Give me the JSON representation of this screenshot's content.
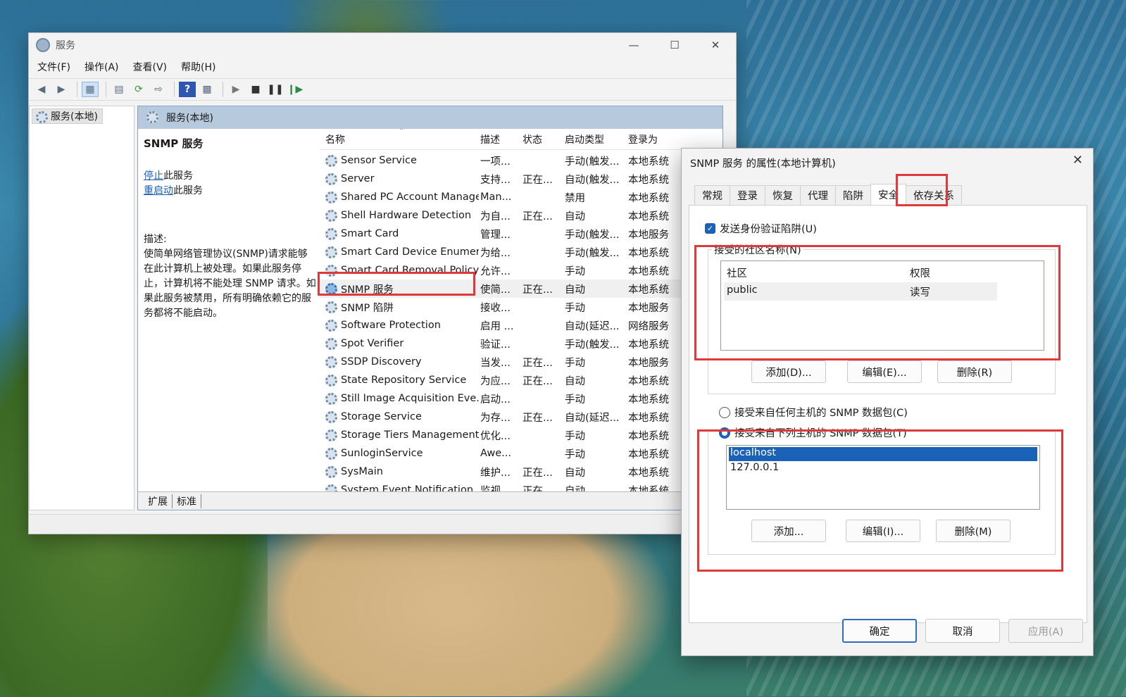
{
  "svc": {
    "title": "服务",
    "menu": [
      "文件(F)",
      "操作(A)",
      "查看(V)",
      "帮助(H)"
    ],
    "tree_item": "服务(本地)",
    "main_header": "服务(本地)",
    "desc": {
      "title": "SNMP 服务",
      "stop_link": "停止",
      "stop_suffix": "此服务",
      "restart_link": "重启动",
      "restart_suffix": "此服务",
      "label": "描述:",
      "body": "使简单网络管理协议(SNMP)请求能够在此计算机上被处理。如果此服务停止，计算机将不能处理 SNMP 请求。如果此服务被禁用，所有明确依赖它的服务都将不能启动。"
    },
    "columns": {
      "name": "名称",
      "desc": "描述",
      "status": "状态",
      "startup": "启动类型",
      "logon": "登录为"
    },
    "rows": [
      {
        "name": "Sensor Service",
        "desc": "一项...",
        "status": "",
        "startup": "手动(触发...",
        "logon": "本地系统"
      },
      {
        "name": "Server",
        "desc": "支持...",
        "status": "正在...",
        "startup": "自动(触发...",
        "logon": "本地系统"
      },
      {
        "name": "Shared PC Account Manager",
        "desc": "Man...",
        "status": "",
        "startup": "禁用",
        "logon": "本地系统"
      },
      {
        "name": "Shell Hardware Detection",
        "desc": "为自...",
        "status": "正在...",
        "startup": "自动",
        "logon": "本地系统"
      },
      {
        "name": "Smart Card",
        "desc": "管理...",
        "status": "",
        "startup": "手动(触发...",
        "logon": "本地服务"
      },
      {
        "name": "Smart Card Device Enumer...",
        "desc": "为给...",
        "status": "",
        "startup": "手动(触发...",
        "logon": "本地系统"
      },
      {
        "name": "Smart Card Removal Policy",
        "desc": "允许...",
        "status": "",
        "startup": "手动",
        "logon": "本地系统"
      },
      {
        "name": "SNMP 服务",
        "desc": "使简...",
        "status": "正在...",
        "startup": "自动",
        "logon": "本地系统"
      },
      {
        "name": "SNMP 陷阱",
        "desc": "接收...",
        "status": "",
        "startup": "手动",
        "logon": "本地服务"
      },
      {
        "name": "Software Protection",
        "desc": "启用 ...",
        "status": "",
        "startup": "自动(延迟...",
        "logon": "网络服务"
      },
      {
        "name": "Spot Verifier",
        "desc": "验证...",
        "status": "",
        "startup": "手动(触发...",
        "logon": "本地系统"
      },
      {
        "name": "SSDP Discovery",
        "desc": "当发...",
        "status": "正在...",
        "startup": "手动",
        "logon": "本地服务"
      },
      {
        "name": "State Repository Service",
        "desc": "为应...",
        "status": "正在...",
        "startup": "自动",
        "logon": "本地系统"
      },
      {
        "name": "Still Image Acquisition Eve...",
        "desc": "启动...",
        "status": "",
        "startup": "手动",
        "logon": "本地系统"
      },
      {
        "name": "Storage Service",
        "desc": "为存...",
        "status": "正在...",
        "startup": "自动(延迟...",
        "logon": "本地系统"
      },
      {
        "name": "Storage Tiers Management",
        "desc": "优化...",
        "status": "",
        "startup": "手动",
        "logon": "本地系统"
      },
      {
        "name": "SunloginService",
        "desc": "Awe...",
        "status": "",
        "startup": "手动",
        "logon": "本地系统"
      },
      {
        "name": "SysMain",
        "desc": "维护...",
        "status": "正在...",
        "startup": "自动",
        "logon": "本地系统"
      },
      {
        "name": "System Event Notification...",
        "desc": "监视...",
        "status": "正在...",
        "startup": "自动",
        "logon": "本地系统"
      }
    ],
    "bottom_tabs": [
      "扩展",
      "标准"
    ]
  },
  "dlg": {
    "title": "SNMP 服务 的属性(本地计算机)",
    "tabs": [
      "常规",
      "登录",
      "恢复",
      "代理",
      "陷阱",
      "安全",
      "依存关系"
    ],
    "send_auth_trap": "发送身份验证陷阱(U)",
    "community_group": "接受的社区名称(N)",
    "community_cols": [
      "社区",
      "权限"
    ],
    "community_rows": [
      {
        "community": "public",
        "rights": "读写"
      }
    ],
    "btn_add1": "添加(D)...",
    "btn_edit1": "编辑(E)...",
    "btn_del1": "删除(R)",
    "radio_any": "接受来自任何主机的 SNMP 数据包(C)",
    "radio_these": "接受来自下列主机的 SNMP 数据包(T)",
    "hosts": [
      "localhost",
      "127.0.0.1"
    ],
    "btn_add2": "添加...",
    "btn_edit2": "编辑(I)...",
    "btn_del2": "删除(M)",
    "ok": "确定",
    "cancel": "取消",
    "apply": "应用(A)"
  },
  "colors": {
    "highlight": "#e0393b",
    "accent": "#1a62b8"
  }
}
